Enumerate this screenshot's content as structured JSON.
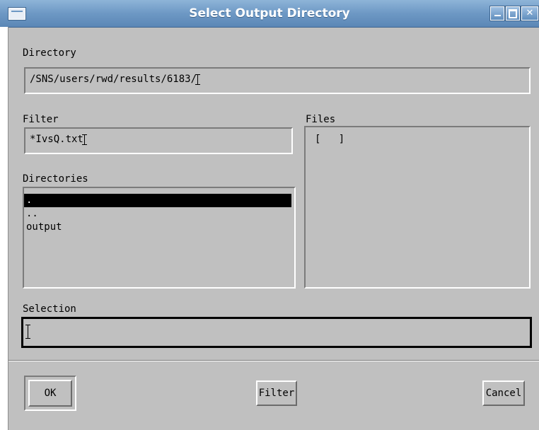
{
  "window": {
    "title": "Select Output Directory"
  },
  "directory": {
    "label": "Directory",
    "value": "/SNS/users/rwd/results/6183/"
  },
  "filter": {
    "label": "Filter",
    "value": "*IvsQ.txt"
  },
  "files": {
    "label": "Files",
    "items": [
      "[   ]"
    ]
  },
  "directories": {
    "label": "Directories",
    "items": [
      ".",
      "..",
      "output"
    ],
    "selected_index": 0
  },
  "selection": {
    "label": "Selection",
    "value": ""
  },
  "buttons": {
    "ok": "OK",
    "filter": "Filter",
    "cancel": "Cancel"
  }
}
